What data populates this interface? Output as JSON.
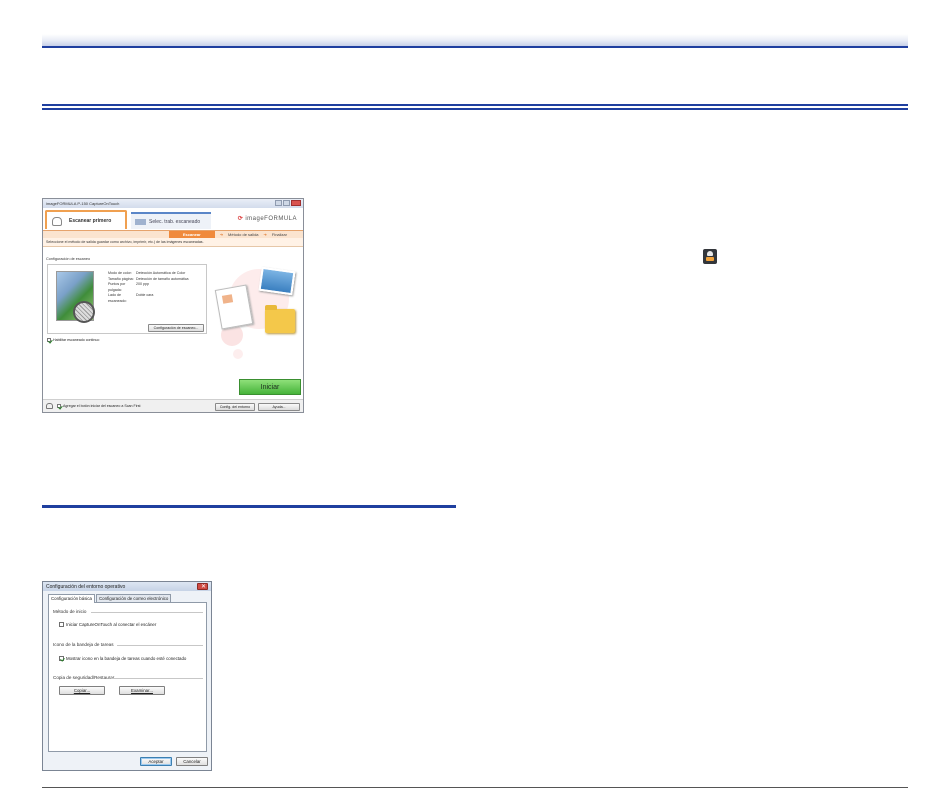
{
  "capture_window": {
    "title": "imageFORMULA P-150 CaptureOnTouch",
    "tabs": [
      {
        "label": "Escanear primero"
      },
      {
        "label": "Selec. trab. escaneado"
      }
    ],
    "brand": "imageFORMULA",
    "steps": [
      "Escanear",
      "Método de salida",
      "Finalizar"
    ],
    "instruction": "Seleccione el método de salida guardar como archivo, imprimir, etc.) de las imágenes escaneadas.",
    "config_title": "Configuración de escaneo",
    "settings": [
      {
        "key": "Modo de color:",
        "value": "Detección Automática de Color"
      },
      {
        "key": "Tamaño página:",
        "value": "Detección de tamaño automática"
      },
      {
        "key": "Puntos por pulgada:",
        "value": "200 ppp"
      },
      {
        "key": "Lado de escaneado:",
        "value": "Doble cara"
      }
    ],
    "config_button": "Configuración de escaneo...",
    "continuous_scan": "Habilitar escaneado continuo",
    "start_button": "Iniciar",
    "footer_checkbox": "Agregar el botón iniciar del escaneo a Scan First",
    "env_button": "Config. del entorno",
    "help_button": "Ayuda..."
  },
  "env_dialog": {
    "title": "Configuración del entorno operativo",
    "tabs": [
      "Configuración básica",
      "Configuración de correo electrónico"
    ],
    "group_start": "Método de inicio",
    "start_check": "Iniciar CaptureOnTouch al conectar el escáner",
    "group_tray": "Icono de la bandeja de tareas",
    "tray_check": "Mostrar icono en la bandeja de tareas cuando esté conectado",
    "group_backup": "Copia de seguridad/Restaurar",
    "copy_button": "Copiar...",
    "browse_button": "Examinar...",
    "ok_button": "Aceptar",
    "cancel_button": "Cancelar"
  }
}
